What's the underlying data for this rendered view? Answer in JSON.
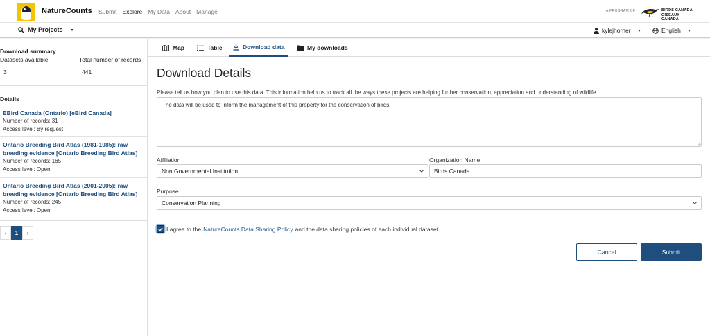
{
  "header": {
    "brand": "NatureCounts",
    "nav": [
      "Submit",
      "Explore",
      "My Data",
      "About",
      "Manage"
    ],
    "active_nav": "Explore",
    "program_label": "A PROGRAM OF",
    "partner_line1": "BIRDS CANADA",
    "partner_line2": "OISEAUX CANADA"
  },
  "subbar": {
    "projects_label": "My Projects",
    "username": "kylejhorner",
    "language": "English"
  },
  "sidebar": {
    "summary_title": "Download summary",
    "datasets_label": "Datasets available",
    "records_label": "Total number of records",
    "datasets_value": "3",
    "records_value": "441",
    "details_title": "Details",
    "datasets": [
      {
        "name": "EBird Canada (Ontario) [eBird Canada]",
        "records": "Number of records: 31",
        "access": "Access level: By request"
      },
      {
        "name": "Ontario Breeding Bird Atlas (1981-1985): raw breeding evidence [Ontario Breeding Bird Atlas]",
        "records": "Number of records: 165",
        "access": "Access level: Open"
      },
      {
        "name": "Ontario Breeding Bird Atlas (2001-2005): raw breeding evidence [Ontario Breeding Bird Atlas]",
        "records": "Number of records: 245",
        "access": "Access level: Open"
      }
    ],
    "pager": {
      "prev": "‹",
      "current": "1",
      "next": "›"
    }
  },
  "tabs": [
    {
      "label": "Map",
      "icon": "map-icon"
    },
    {
      "label": "Table",
      "icon": "list-icon"
    },
    {
      "label": "Download data",
      "icon": "download-icon"
    },
    {
      "label": "My downloads",
      "icon": "folder-icon"
    }
  ],
  "active_tab": "Download data",
  "form": {
    "title": "Download Details",
    "intro": "Please tell us how you plan to use this data. This information help us to track all the ways these projects are helping further conservation, appreciation and understanding of wildlife",
    "usage_text": "The data will be used to inform the management of this property for the conservation of birds.",
    "affiliation_label": "Affiliation",
    "affiliation_value": "Non Governmental Institution",
    "org_label": "Organization Name",
    "org_value": "Birds Canada",
    "purpose_label": "Purpose",
    "purpose_value": "Conservation Planning",
    "consent_pre": "I agree to the",
    "consent_link": "NatureCounts Data Sharing Policy",
    "consent_post": "and the data sharing policies of each individual dataset.",
    "consent_checked": true,
    "cancel_label": "Cancel",
    "submit_label": "Submit"
  },
  "colors": {
    "accent": "#1e4e7e",
    "logo_yellow": "#f5c400"
  }
}
